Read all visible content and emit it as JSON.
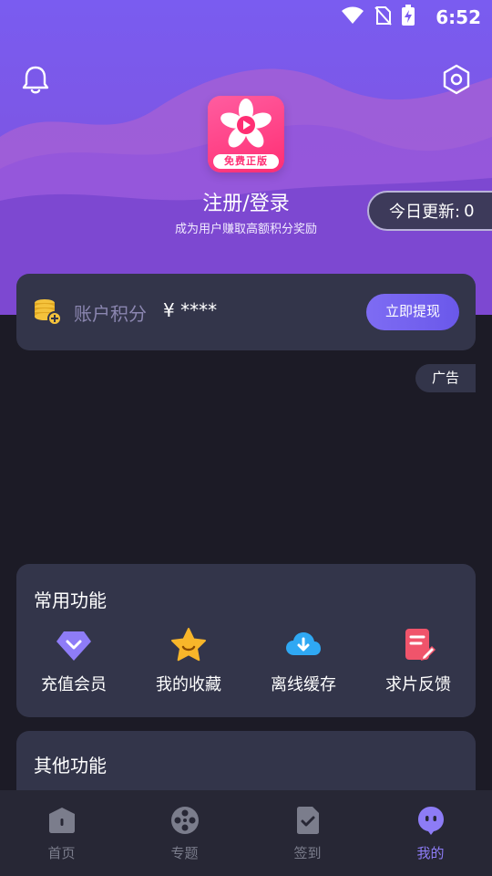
{
  "status_bar": {
    "time": "6:52"
  },
  "profile": {
    "login_title": "注册/登录",
    "login_subtitle": "成为用户赚取高额积分奖励",
    "logo_badge": "免费正版",
    "update_label": "今日更新:",
    "update_count": "0"
  },
  "points": {
    "label": "账户积分",
    "value": "¥ ****",
    "withdraw_label": "立即提现"
  },
  "ad": {
    "tag": "广告"
  },
  "common_functions": {
    "title": "常用功能",
    "items": [
      {
        "label": "充值会员",
        "icon": "diamond-icon"
      },
      {
        "label": "我的收藏",
        "icon": "star-icon"
      },
      {
        "label": "离线缓存",
        "icon": "cloud-download-icon"
      },
      {
        "label": "求片反馈",
        "icon": "feedback-icon"
      }
    ]
  },
  "other_functions": {
    "title": "其他功能"
  },
  "tabbar": {
    "items": [
      {
        "label": "首页",
        "icon": "home-icon",
        "active": false
      },
      {
        "label": "专题",
        "icon": "film-reel-icon",
        "active": false
      },
      {
        "label": "签到",
        "icon": "checkin-icon",
        "active": false
      },
      {
        "label": "我的",
        "icon": "profile-icon",
        "active": true
      }
    ]
  },
  "colors": {
    "accent": "#7e6cf3",
    "background": "#1c1b26",
    "card": "#33354a",
    "active_tab": "#8d7cf6"
  }
}
